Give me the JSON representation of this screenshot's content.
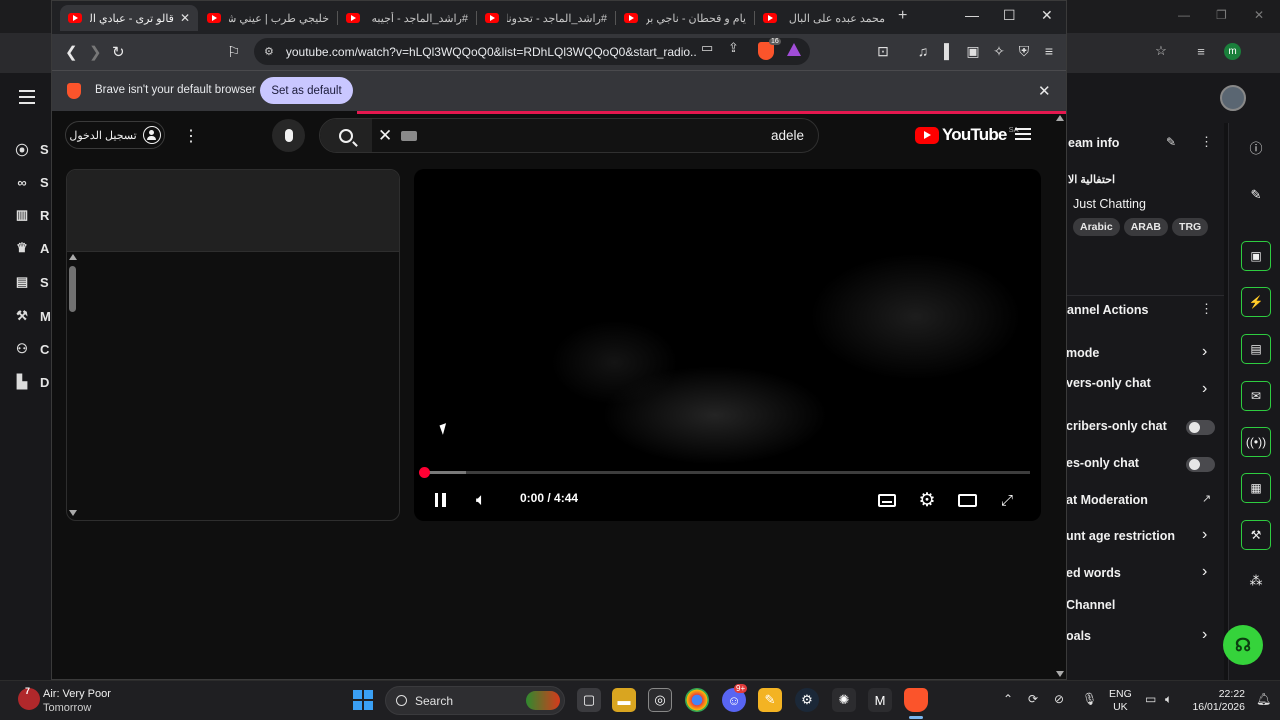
{
  "browser": {
    "tabs": [
      {
        "label": "قالو ترى - عبادي الـ",
        "active": true
      },
      {
        "label": "خليجي طرب | عيني شا",
        "active": false
      },
      {
        "label": "#راشد_الماجد - أجيبه |",
        "active": false
      },
      {
        "label": "#راشد_الماجد - تحدونا |",
        "active": false
      },
      {
        "label": "يام و قحطان - ناجي بن",
        "active": false
      },
      {
        "label": "محمد عبده على البال لا",
        "active": false
      }
    ],
    "url": "youtube.com/watch?v=hLQl3WQQoQ0&list=RDhLQl3WQQoQ0&start_radio...",
    "shield_count": "16",
    "infobar": {
      "message": "Brave isn't your default browser",
      "set_default_label": "Set as default"
    }
  },
  "youtube": {
    "signin_label": "تسجيل الدخول",
    "search_query": "adele",
    "logo_text": "YouTube",
    "region": "SA",
    "player": {
      "time": "0:00 / 4:44",
      "progress": 0.0,
      "buffered": 0.07
    }
  },
  "background_app": {
    "left_nav": [
      {
        "icon": "broadcast-icon",
        "letter": "S"
      },
      {
        "icon": "link-icon",
        "letter": "S"
      },
      {
        "icon": "bar-chart-icon",
        "letter": "R"
      },
      {
        "icon": "trophy-icon",
        "letter": "A"
      },
      {
        "icon": "list-icon",
        "letter": "S"
      },
      {
        "icon": "wrench-icon",
        "letter": "M"
      },
      {
        "icon": "people-icon",
        "letter": "C"
      },
      {
        "icon": "dashboard-icon",
        "letter": "D"
      }
    ],
    "stream_info": {
      "title": "eam info",
      "stream_title": "احتفالية الا",
      "category": "Just Chatting",
      "tags": [
        "Arabic",
        "ARAB",
        "TRG"
      ]
    },
    "channel_actions": {
      "title": "annel Actions",
      "items": [
        {
          "label": "mode",
          "control": "chevron"
        },
        {
          "label": "vers-only chat",
          "control": "chevron"
        },
        {
          "label": "cribers-only chat",
          "control": "toggle"
        },
        {
          "label": "es-only chat",
          "control": "toggle"
        },
        {
          "label": "at Moderation",
          "control": "external"
        },
        {
          "label": "unt age restriction",
          "control": "chevron"
        },
        {
          "label": "ed words",
          "control": "chevron"
        },
        {
          "label": "Channel",
          "control": "none"
        },
        {
          "label": "oals",
          "control": "chevron"
        }
      ]
    }
  },
  "taskbar": {
    "weather_line1": "Air: Very Poor",
    "weather_line2": "Tomorrow",
    "weather_badge": "7",
    "search_label": "Search",
    "discord_badge": "9+",
    "lang_line1": "ENG",
    "lang_line2": "UK",
    "time": "22:22",
    "date": "16/01/2026"
  },
  "colors": {
    "youtube_red": "#ff0000",
    "progress_red": "#ff0033",
    "brave_orange": "#fb542b",
    "infobar_button": "#c9c7ff",
    "kick_green": "#35d33b"
  }
}
